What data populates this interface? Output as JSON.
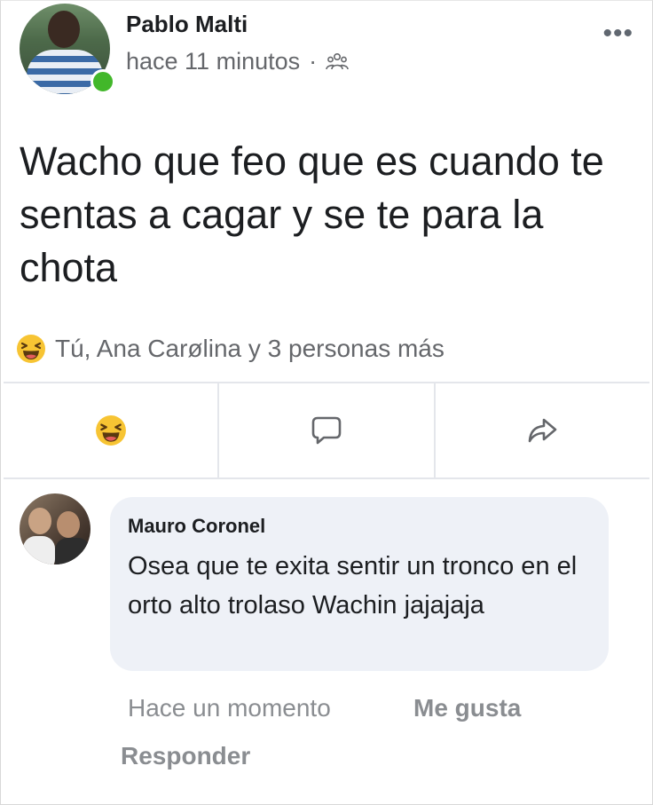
{
  "post": {
    "author": "Pablo Malti",
    "time": "hace 11 minutos",
    "separator": "·",
    "privacy_icon": "friends-icon",
    "more_label": "•••",
    "text": "Wacho que feo que es cuando te sentas a cagar y se te para la chota",
    "reactions_icon": "haha-icon",
    "reactions_summary": "Tú, Ana Carølina y 3 personas más",
    "online_status_color": "#42b72a"
  },
  "actions": [
    {
      "icon": "haha-icon"
    },
    {
      "icon": "comment-icon"
    },
    {
      "icon": "share-icon"
    }
  ],
  "comment": {
    "author": "Mauro Coronel",
    "text": "Osea que te exita sentir un tronco en el orto alto trolaso Wachin jajajaja",
    "time": "Hace un momento",
    "like_label": "Me gusta",
    "reply_label": "Responder"
  }
}
